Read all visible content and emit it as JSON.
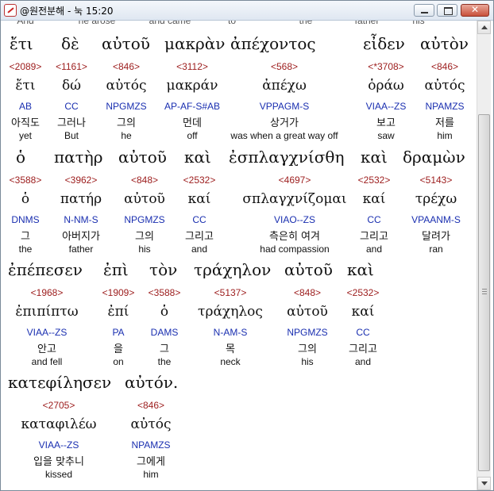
{
  "window": {
    "title": "@원전분해 - 눅 15:20"
  },
  "cut_row": [
    "And",
    "he arose",
    "and came",
    "to",
    "the",
    "father",
    "his"
  ],
  "rows": [
    {
      "greek": [
        "ἔτι",
        "δὲ",
        "αὐτοῦ",
        "μακρὰν",
        "ἀπέχοντος",
        "εἶδεν",
        "αὐτὸν"
      ],
      "strong": [
        "<2089>",
        "<1161>",
        "<846>",
        "<3112>",
        "<568>",
        "<*3708>",
        "<846>"
      ],
      "lemma": [
        "ἔτι",
        "δώ",
        "αὐτός",
        "μακράν",
        "ἀπέχω",
        "ὁράω",
        "αὐτός"
      ],
      "parse": [
        "AB",
        "CC",
        "NPGMZS",
        "AP-AF-S#AB",
        "VPPAGM-S",
        "VIAA--ZS",
        "NPAMZS"
      ],
      "korean": [
        "아직도",
        "그러나",
        "그의",
        "먼데",
        "상거가",
        "보고",
        "저를"
      ],
      "english": [
        "yet",
        "But",
        "he",
        "off",
        "was when a great way off",
        "saw",
        "him"
      ]
    },
    {
      "greek": [
        "ὁ",
        "πατὴρ",
        "αὐτοῦ",
        "καὶ",
        "ἐσπλαγχνίσθη",
        "καὶ",
        "δραμὼν"
      ],
      "strong": [
        "<3588>",
        "<3962>",
        "<848>",
        "<2532>",
        "<4697>",
        "<2532>",
        "<5143>"
      ],
      "lemma": [
        "ὁ",
        "πατήρ",
        "αὐτοῦ",
        "καί",
        "σπλαγχνίζομαι",
        "καί",
        "τρέχω"
      ],
      "parse": [
        "DNMS",
        "N-NM-S",
        "NPGMZS",
        "CC",
        "VIAO--ZS",
        "CC",
        "VPAANM-S"
      ],
      "korean": [
        "그",
        "아버지가",
        "그의",
        "그리고",
        "측은히 여겨",
        "그리고",
        "달려가"
      ],
      "english": [
        "the",
        "father",
        "his",
        "and",
        "had compassion",
        "and",
        "ran"
      ]
    },
    {
      "greek": [
        "ἐπέπεσεν",
        "ἐπὶ",
        "τὸν",
        "τράχηλον",
        "αὐτοῦ",
        "καὶ"
      ],
      "strong": [
        "<1968>",
        "<1909>",
        "<3588>",
        "<5137>",
        "<848>",
        "<2532>"
      ],
      "lemma": [
        "ἐπιπίπτω",
        "ἐπί",
        "ὁ",
        "τράχηλος",
        "αὐτοῦ",
        "καί"
      ],
      "parse": [
        "VIAA--ZS",
        "PA",
        "DAMS",
        "N-AM-S",
        "NPGMZS",
        "CC"
      ],
      "korean": [
        "안고",
        "을",
        "그",
        "목",
        "그의",
        "그리고"
      ],
      "english": [
        "and fell",
        "on",
        "the",
        "neck",
        "his",
        "and"
      ]
    },
    {
      "greek": [
        "κατεφίλησεν",
        "αὐτόν."
      ],
      "strong": [
        "<2705>",
        "<846>"
      ],
      "lemma": [
        "καταφιλέω",
        "αὐτός"
      ],
      "parse": [
        "VIAA--ZS",
        "NPAMZS"
      ],
      "korean": [
        "입을 맞추니",
        "그에게"
      ],
      "english": [
        "kissed",
        "him"
      ]
    }
  ],
  "colors": {
    "strong": "#9c1c1c",
    "parse": "#1a2fb0",
    "text": "#111111"
  },
  "icons": {
    "app": "app-icon",
    "minimize": "minimize-icon",
    "maximize": "maximize-icon",
    "close": "close-icon"
  }
}
